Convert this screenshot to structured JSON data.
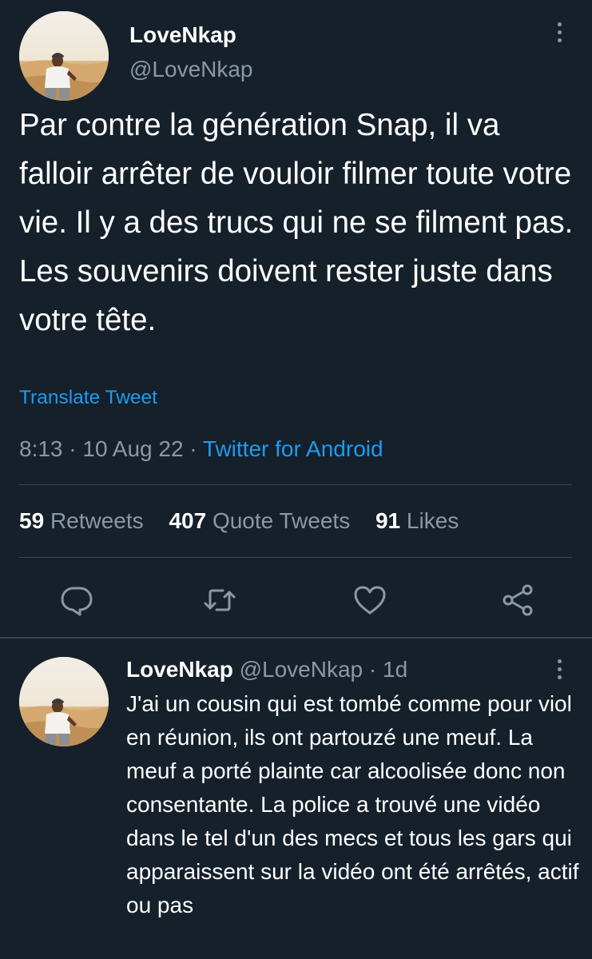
{
  "colors": {
    "background": "#15202b",
    "text_primary": "#ffffff",
    "text_secondary": "#8b98a5",
    "accent": "#1d9bf0",
    "divider": "#38444d"
  },
  "main_tweet": {
    "author": {
      "display_name": "LoveNkap",
      "handle": "@LoveNkap"
    },
    "text": "Par contre la génération Snap, il va falloir arrêter de vouloir filmer toute votre vie. Il y a des trucs qui ne se filment pas. Les souvenirs doivent rester juste dans votre tête.",
    "translate_label": "Translate Tweet",
    "time": "8:13",
    "date": "10 Aug 22",
    "separator": "·",
    "source": "Twitter for Android",
    "stats": {
      "retweets_count": "59",
      "retweets_label": "Retweets",
      "quotes_count": "407",
      "quotes_label": "Quote Tweets",
      "likes_count": "91",
      "likes_label": "Likes"
    },
    "actions": [
      "reply-icon",
      "retweet-icon",
      "like-icon",
      "share-icon"
    ]
  },
  "reply_tweet": {
    "author": {
      "display_name": "LoveNkap",
      "handle": "@LoveNkap"
    },
    "separator": "·",
    "age": "1d",
    "text": "J'ai un cousin qui est tombé comme pour viol en réunion, ils ont partouzé une meuf. La meuf a porté plainte car alcoolisée donc non consentante. La police a trouvé une vidéo dans le tel d'un des mecs et tous les gars qui apparaissent sur la vidéo ont été arrêtés, actif ou pas"
  }
}
